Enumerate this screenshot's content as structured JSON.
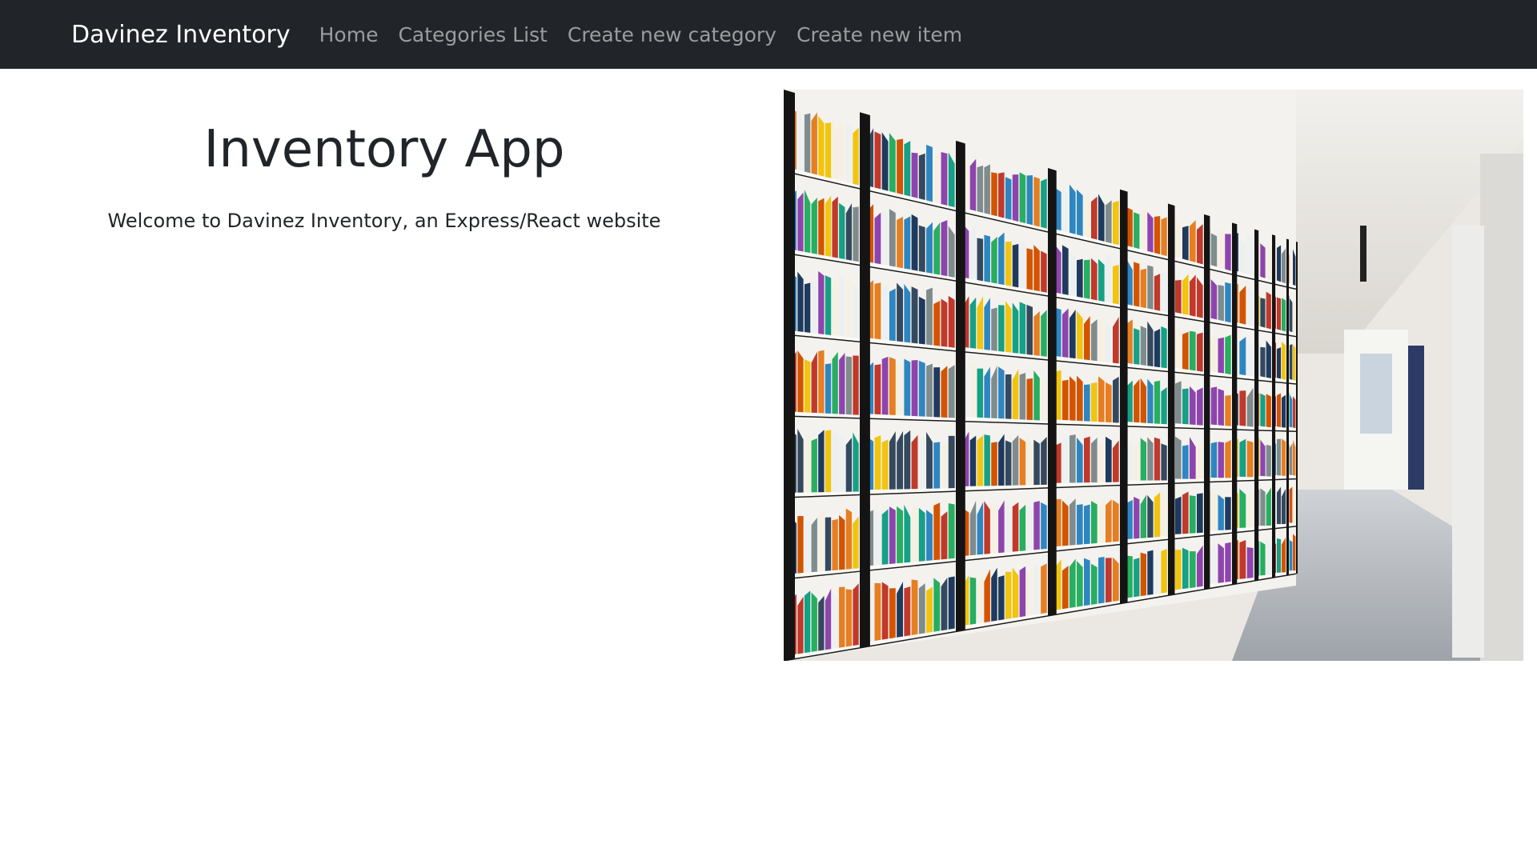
{
  "navbar": {
    "brand": "Davinez Inventory",
    "links": [
      {
        "label": "Home"
      },
      {
        "label": "Categories List"
      },
      {
        "label": "Create new category"
      },
      {
        "label": "Create new item"
      }
    ]
  },
  "hero": {
    "title": "Inventory App",
    "subtitle": "Welcome to Davinez Inventory, an Express/React website"
  },
  "image": {
    "subject": "library-bookshelves-photo"
  },
  "colors": {
    "navbar_bg": "#212529",
    "brand_text": "#ffffff",
    "nav_link_text": "#9a9d9f",
    "body_text": "#212529"
  }
}
